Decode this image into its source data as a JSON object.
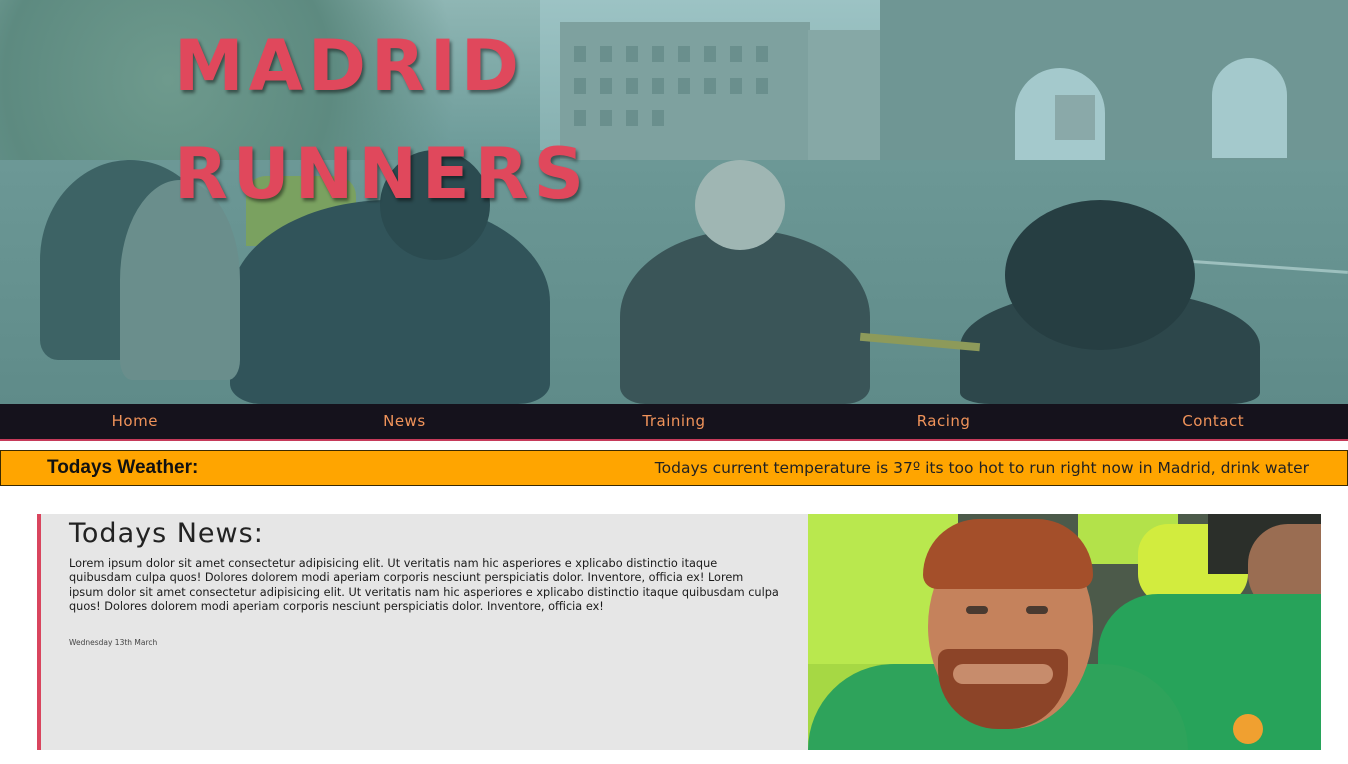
{
  "hero": {
    "title_line1": "MADRID",
    "title_line2": "RUNNERS",
    "title_color": "#e0485c"
  },
  "nav": {
    "items": [
      "Home",
      "News",
      "Training",
      "Racing",
      "Contact"
    ],
    "text_color": "#f0935a",
    "background": "#15121c"
  },
  "weather": {
    "label": "Todays Weather:",
    "message": "Todays current temperature is 37º its too hot to run right now in Madrid, drink water",
    "background": "#ffa500"
  },
  "news": {
    "heading": "Todays News:",
    "body": "Lorem ipsum dolor sit amet consectetur adipisicing elit. Ut veritatis nam hic asperiores e xplicabo distinctio itaque quibusdam culpa quos! Dolores dolorem modi aperiam corporis nesciunt perspiciatis dolor. Inventore, officia ex! Lorem ipsum dolor sit amet consectetur adipisicing elit. Ut veritatis nam hic asperiores e xplicabo distinctio itaque quibusdam culpa quos! Dolores dolorem modi aperiam corporis nesciunt perspiciatis dolor. Inventore, officia ex!",
    "date": "Wednesday 13th March",
    "accent_color": "#d9455e"
  }
}
